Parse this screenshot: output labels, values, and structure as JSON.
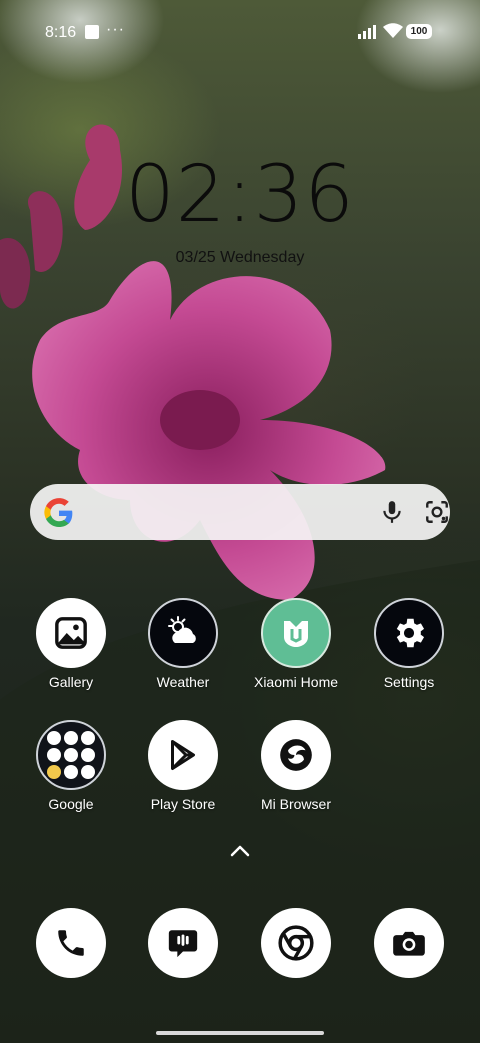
{
  "status_bar": {
    "time": "8:16",
    "dots": "···",
    "battery": "100"
  },
  "lock": {
    "clock": "02:36",
    "date": "03/25 Wednesday"
  },
  "search": {
    "logo": "google-g-icon"
  },
  "apps": [
    {
      "label": "Gallery",
      "icon": "gallery-icon"
    },
    {
      "label": "Weather",
      "icon": "weather-icon"
    },
    {
      "label": "Xiaomi Home",
      "icon": "xiaomi-home-icon"
    },
    {
      "label": "Settings",
      "icon": "gear-icon"
    },
    {
      "label": "Google",
      "icon": "google-folder-icon"
    },
    {
      "label": "Play Store",
      "icon": "play-store-icon"
    },
    {
      "label": "Mi Browser",
      "icon": "mi-browser-icon"
    }
  ],
  "dock": [
    {
      "icon": "phone-icon"
    },
    {
      "icon": "messages-icon"
    },
    {
      "icon": "chrome-icon"
    },
    {
      "icon": "camera-icon"
    }
  ],
  "colors": {
    "accent_green": "#5fbe95",
    "icon_dark": "#05070d",
    "search_bar": "#f5f5f5"
  }
}
